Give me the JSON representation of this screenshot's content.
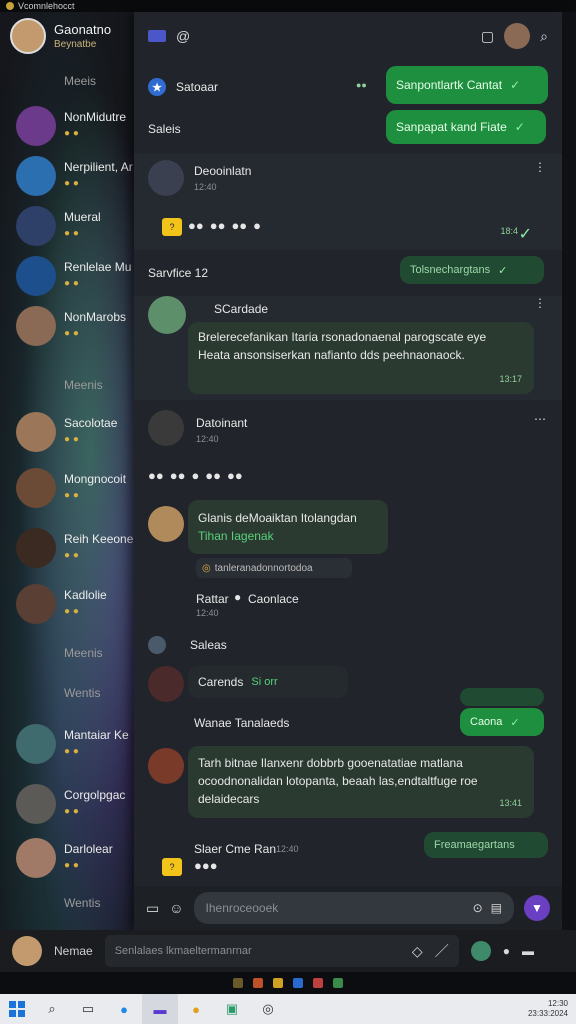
{
  "titlebar": {
    "title": "Vcomnlehocct"
  },
  "me": {
    "name": "Gaonatno",
    "sub": "Beynatbe"
  },
  "sidebar": {
    "sections": [
      "Meeis",
      "Meenis",
      "Meenis",
      "Wentis",
      "Wentis"
    ],
    "chats": [
      {
        "name": "NonMidutre",
        "meta": "● ●"
      },
      {
        "name": "Nerpilient, Ar",
        "meta": "● ●"
      },
      {
        "name": "Mueral",
        "meta": "● ●"
      },
      {
        "name": "Renlelae Mu",
        "meta": "● ●"
      },
      {
        "name": "NonMarobs",
        "meta": "● ●"
      },
      {
        "name": "Sacolotae",
        "meta": "● ●"
      },
      {
        "name": "Mongnocoit",
        "meta": "● ●"
      },
      {
        "name": "Reih Keeone",
        "meta": "● ●"
      },
      {
        "name": "Kadlolie",
        "meta": "● ●"
      },
      {
        "name": "Mantaiar Ke",
        "meta": "● ●"
      },
      {
        "name": "Corgolpgac",
        "meta": "● ●"
      },
      {
        "name": "Darlolear",
        "meta": "● ●"
      }
    ]
  },
  "main": {
    "msg1": {
      "sender": "Satoaar",
      "bubble": "Sanpontlartk Cantat",
      "time": "●●"
    },
    "msg2": {
      "sender": "Saleis",
      "bubble": "Sanpapat kand Fiate"
    },
    "msg3": {
      "sender": "Deooinlatn",
      "time": "12:40",
      "time2": "18:4"
    },
    "msg4": {
      "sender": "Sarvfice 12",
      "bubble": "Tolsnechargtans"
    },
    "msg5": {
      "sender": "SCardade",
      "text": "Brelerecefanikan Itaria rsonadonaenal parogscate eye Heata ansonsiserkan nafianto dds peehnaonaock.",
      "time": "13:17"
    },
    "msg6": {
      "sender": "Datoinant",
      "time": "12:40"
    },
    "msg7": {
      "text": "Glanis deMoaiktan Itolangdan",
      "link": "Tihan Iagenak",
      "chip": "tanleranadonnortodoa"
    },
    "msg8": {
      "sender": "Rattar",
      "extra": "Caonlace",
      "time": "12:40"
    },
    "msg9": {
      "sender": "Saleas"
    },
    "msg10": {
      "sender": "Carends",
      "extra": "Si orr"
    },
    "msg11": {
      "sender": "Wanae Tanalaeds",
      "bubble": "Caona"
    },
    "msg12": {
      "text": "Tarh bitnae Ilanxenr dobbrb gooenatatiae matlana ocoodnonalidan lotopanta, beaah las,endtaltfuge roe delaidecars",
      "time": "13:41"
    },
    "msg13": {
      "sender": "Slaer Cme Ran",
      "time": "12:40",
      "bubble": "Freamaegartans"
    },
    "composer": {
      "placeholder": "Ihenroceooek"
    }
  },
  "bottom": {
    "name": "Nemae",
    "placeholder": "Senlalaes lkmaeltermanrnar"
  },
  "taskbar": {
    "clock1": "12:30",
    "clock2": "23:33:2024"
  }
}
